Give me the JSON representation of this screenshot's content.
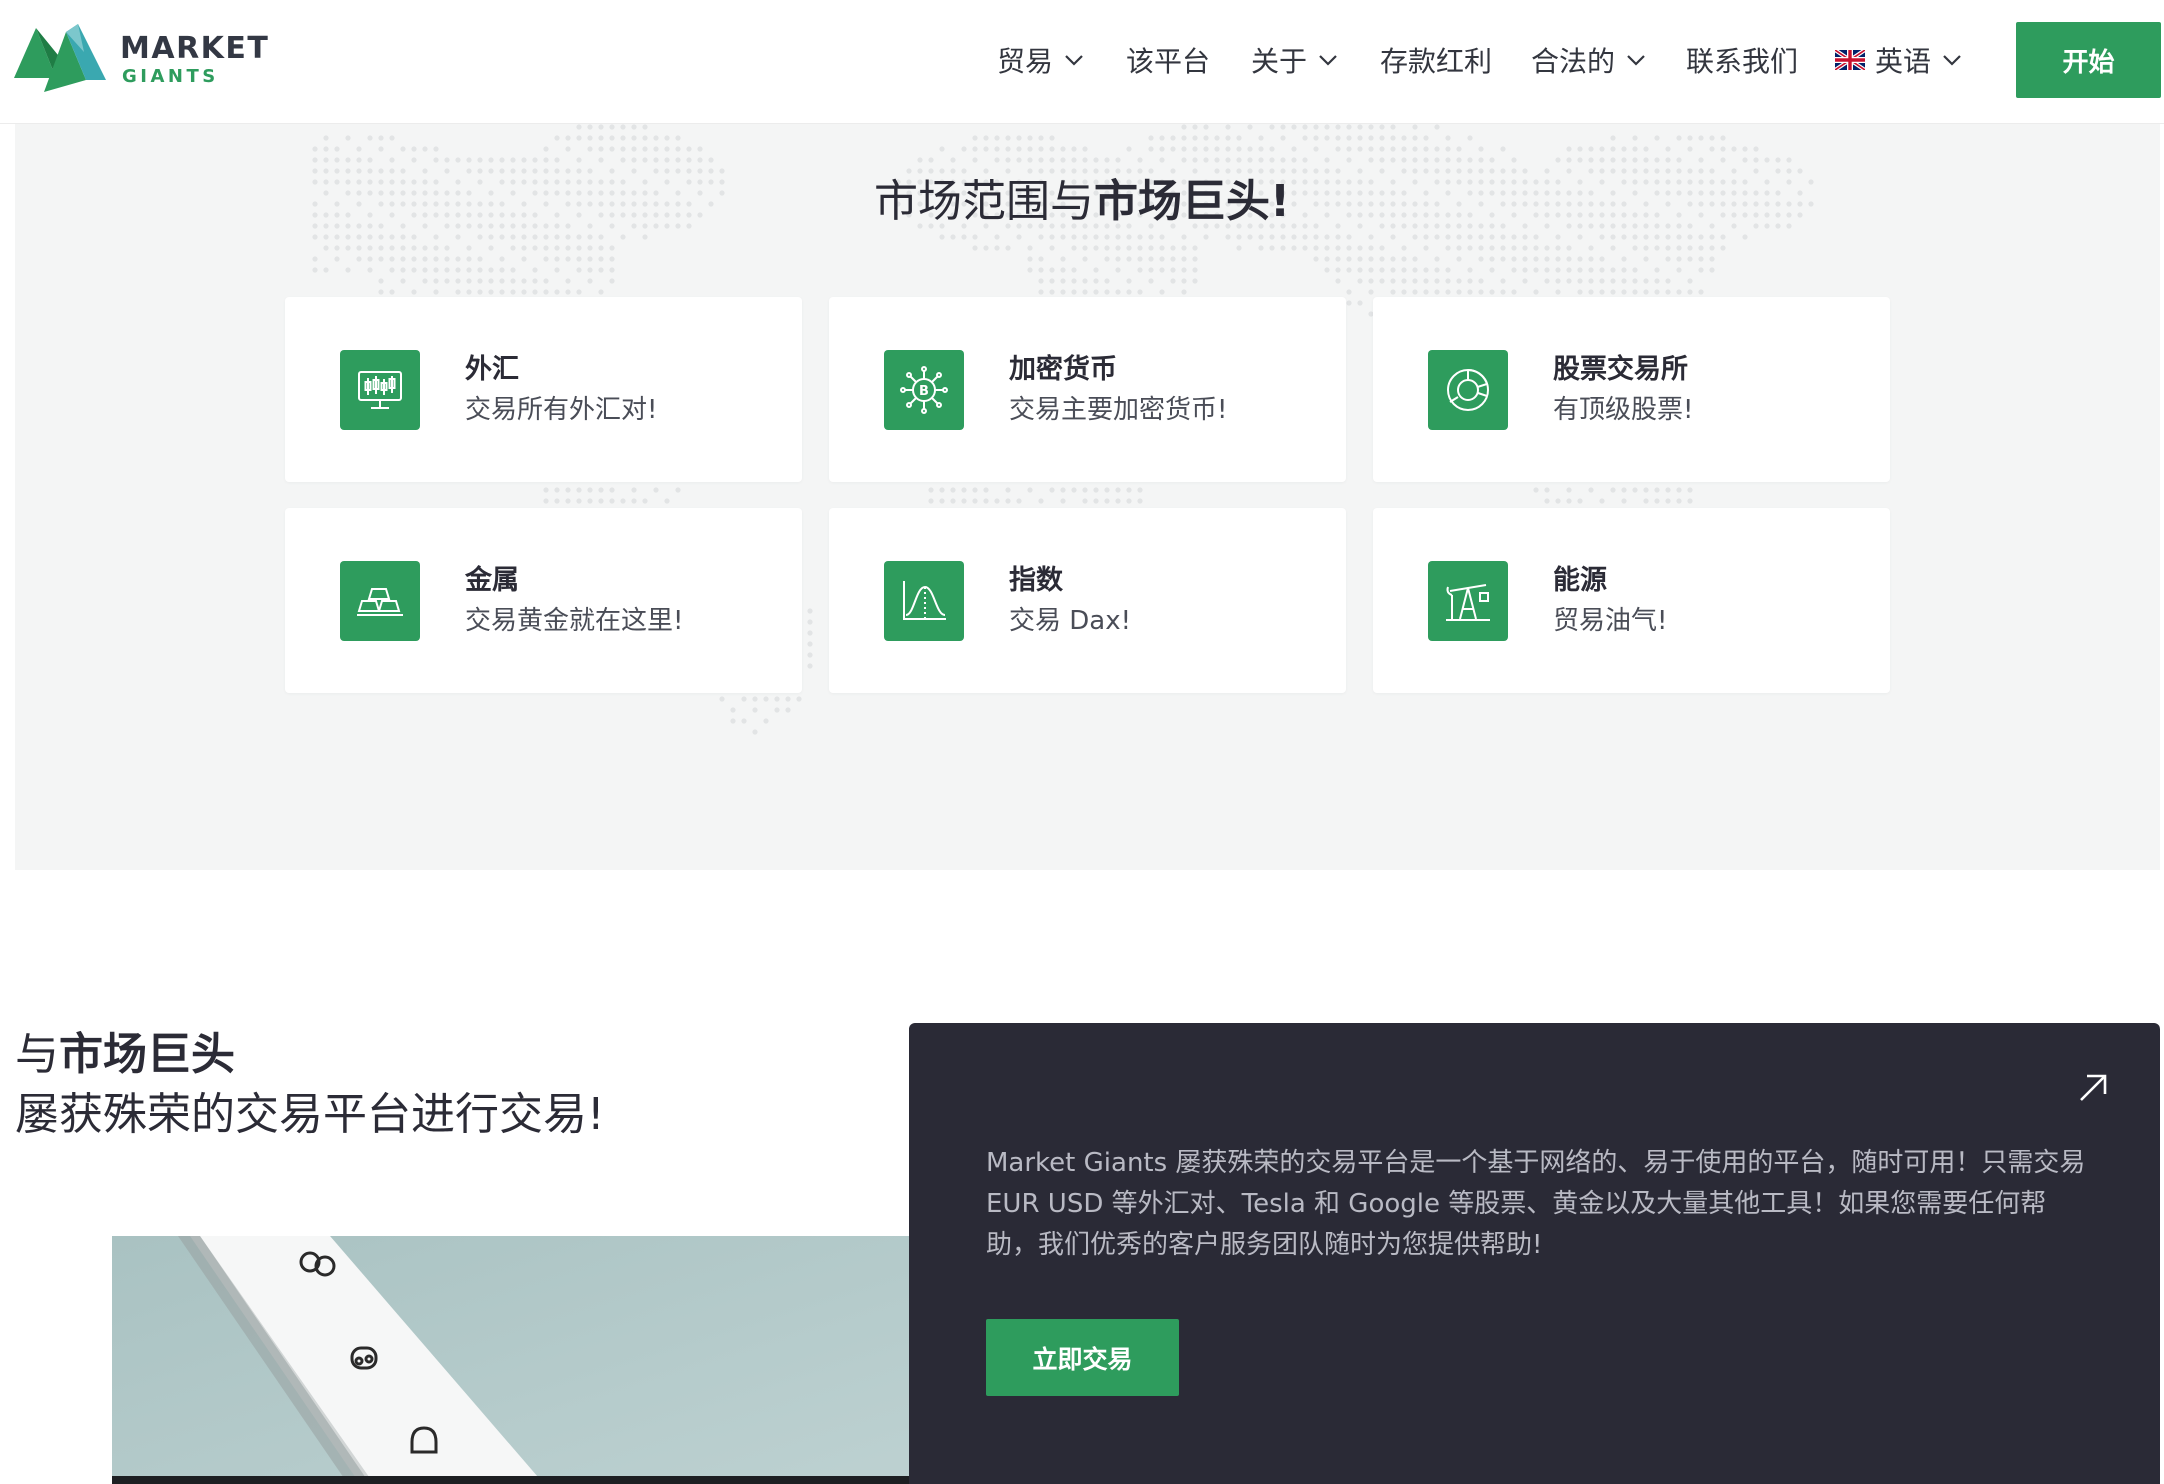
{
  "brand": {
    "name": "MARKET",
    "sub": "GIANTS",
    "green": "#2e9c5d",
    "teal": "#3aa8b0"
  },
  "nav": {
    "items": [
      {
        "label": "贸易",
        "dropdown": true
      },
      {
        "label": "该平台",
        "dropdown": false
      },
      {
        "label": "关于",
        "dropdown": true
      },
      {
        "label": "存款红利",
        "dropdown": false
      },
      {
        "label": "合法的",
        "dropdown": true
      },
      {
        "label": "联系我们",
        "dropdown": false
      }
    ],
    "language": {
      "label": "英语",
      "flag": "uk-flag-icon"
    },
    "start_label": "开始"
  },
  "markets": {
    "title_normal": "市场范围与",
    "title_bold": "市场巨头!",
    "cards": [
      {
        "icon": "monitor-chart-icon",
        "title": "外汇",
        "sub": "交易所有外汇对!"
      },
      {
        "icon": "bitcoin-network-icon",
        "title": "加密货币",
        "sub": "交易主要加密货币!"
      },
      {
        "icon": "pie-chart-icon",
        "title": "股票交易所",
        "sub": "有顶级股票!"
      },
      {
        "icon": "gold-bars-icon",
        "title": "金属",
        "sub": "交易黄金就在这里!"
      },
      {
        "icon": "bell-curve-icon",
        "title": "指数",
        "sub": "交易 Dax!"
      },
      {
        "icon": "oil-pump-icon",
        "title": "能源",
        "sub": "贸易油气!"
      }
    ]
  },
  "platform": {
    "title_normal": "与",
    "title_bold": "市场巨头",
    "subtitle": "屡获殊荣的交易平台进行交易!",
    "description": "Market Giants 屡获殊荣的交易平台是一个基于网络的、易于使用的平台，随时可用！只需交易 EUR USD 等外汇对、Tesla 和 Google 等股票、黄金以及大量其他工具！如果您需要任何帮助，我们优秀的客户服务团队随时为您提供帮助!",
    "trade_label": "立即交易",
    "panel_color": "#2a2a36"
  }
}
